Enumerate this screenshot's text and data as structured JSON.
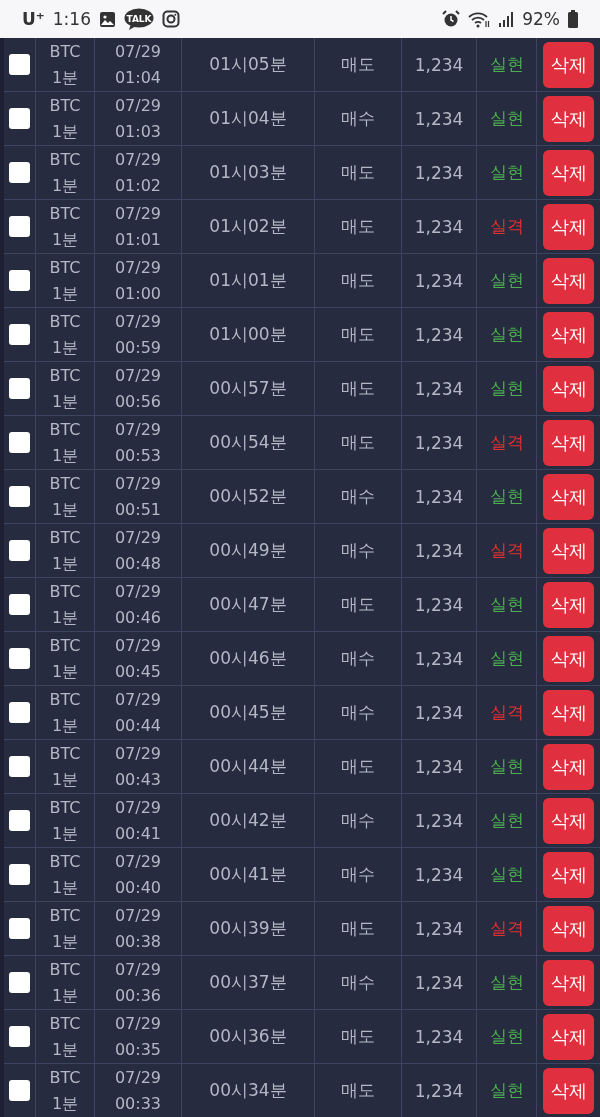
{
  "status_bar": {
    "carrier": "U⁺",
    "time": "1:16",
    "talk_badge": "TALK",
    "battery": "92%"
  },
  "rows": [
    {
      "checked": false,
      "coin": "BTC",
      "interval": "1분",
      "date": "07/29",
      "time": "01:04",
      "slot": "01시05분",
      "side": "매도",
      "amount": "1,234",
      "result": "실현",
      "kind": "win",
      "action": "삭제"
    },
    {
      "checked": false,
      "coin": "BTC",
      "interval": "1분",
      "date": "07/29",
      "time": "01:03",
      "slot": "01시04분",
      "side": "매수",
      "amount": "1,234",
      "result": "실현",
      "kind": "win",
      "action": "삭제"
    },
    {
      "checked": false,
      "coin": "BTC",
      "interval": "1분",
      "date": "07/29",
      "time": "01:02",
      "slot": "01시03분",
      "side": "매도",
      "amount": "1,234",
      "result": "실현",
      "kind": "win",
      "action": "삭제"
    },
    {
      "checked": false,
      "coin": "BTC",
      "interval": "1분",
      "date": "07/29",
      "time": "01:01",
      "slot": "01시02분",
      "side": "매도",
      "amount": "1,234",
      "result": "실격",
      "kind": "loss",
      "action": "삭제"
    },
    {
      "checked": false,
      "coin": "BTC",
      "interval": "1분",
      "date": "07/29",
      "time": "01:00",
      "slot": "01시01분",
      "side": "매도",
      "amount": "1,234",
      "result": "실현",
      "kind": "win",
      "action": "삭제"
    },
    {
      "checked": false,
      "coin": "BTC",
      "interval": "1분",
      "date": "07/29",
      "time": "00:59",
      "slot": "01시00분",
      "side": "매도",
      "amount": "1,234",
      "result": "실현",
      "kind": "win",
      "action": "삭제"
    },
    {
      "checked": false,
      "coin": "BTC",
      "interval": "1분",
      "date": "07/29",
      "time": "00:56",
      "slot": "00시57분",
      "side": "매도",
      "amount": "1,234",
      "result": "실현",
      "kind": "win",
      "action": "삭제"
    },
    {
      "checked": false,
      "coin": "BTC",
      "interval": "1분",
      "date": "07/29",
      "time": "00:53",
      "slot": "00시54분",
      "side": "매도",
      "amount": "1,234",
      "result": "실격",
      "kind": "loss",
      "action": "삭제"
    },
    {
      "checked": false,
      "coin": "BTC",
      "interval": "1분",
      "date": "07/29",
      "time": "00:51",
      "slot": "00시52분",
      "side": "매수",
      "amount": "1,234",
      "result": "실현",
      "kind": "win",
      "action": "삭제"
    },
    {
      "checked": false,
      "coin": "BTC",
      "interval": "1분",
      "date": "07/29",
      "time": "00:48",
      "slot": "00시49분",
      "side": "매수",
      "amount": "1,234",
      "result": "실격",
      "kind": "loss",
      "action": "삭제"
    },
    {
      "checked": false,
      "coin": "BTC",
      "interval": "1분",
      "date": "07/29",
      "time": "00:46",
      "slot": "00시47분",
      "side": "매도",
      "amount": "1,234",
      "result": "실현",
      "kind": "win",
      "action": "삭제"
    },
    {
      "checked": false,
      "coin": "BTC",
      "interval": "1분",
      "date": "07/29",
      "time": "00:45",
      "slot": "00시46분",
      "side": "매수",
      "amount": "1,234",
      "result": "실현",
      "kind": "win",
      "action": "삭제"
    },
    {
      "checked": false,
      "coin": "BTC",
      "interval": "1분",
      "date": "07/29",
      "time": "00:44",
      "slot": "00시45분",
      "side": "매수",
      "amount": "1,234",
      "result": "실격",
      "kind": "loss",
      "action": "삭제"
    },
    {
      "checked": false,
      "coin": "BTC",
      "interval": "1분",
      "date": "07/29",
      "time": "00:43",
      "slot": "00시44분",
      "side": "매도",
      "amount": "1,234",
      "result": "실현",
      "kind": "win",
      "action": "삭제"
    },
    {
      "checked": false,
      "coin": "BTC",
      "interval": "1분",
      "date": "07/29",
      "time": "00:41",
      "slot": "00시42분",
      "side": "매수",
      "amount": "1,234",
      "result": "실현",
      "kind": "win",
      "action": "삭제"
    },
    {
      "checked": false,
      "coin": "BTC",
      "interval": "1분",
      "date": "07/29",
      "time": "00:40",
      "slot": "00시41분",
      "side": "매수",
      "amount": "1,234",
      "result": "실현",
      "kind": "win",
      "action": "삭제"
    },
    {
      "checked": false,
      "coin": "BTC",
      "interval": "1분",
      "date": "07/29",
      "time": "00:38",
      "slot": "00시39분",
      "side": "매도",
      "amount": "1,234",
      "result": "실격",
      "kind": "loss",
      "action": "삭제"
    },
    {
      "checked": false,
      "coin": "BTC",
      "interval": "1분",
      "date": "07/29",
      "time": "00:36",
      "slot": "00시37분",
      "side": "매수",
      "amount": "1,234",
      "result": "실현",
      "kind": "win",
      "action": "삭제"
    },
    {
      "checked": false,
      "coin": "BTC",
      "interval": "1분",
      "date": "07/29",
      "time": "00:35",
      "slot": "00시36분",
      "side": "매도",
      "amount": "1,234",
      "result": "실현",
      "kind": "win",
      "action": "삭제"
    },
    {
      "checked": false,
      "coin": "BTC",
      "interval": "1분",
      "date": "07/29",
      "time": "00:33",
      "slot": "00시34분",
      "side": "매도",
      "amount": "1,234",
      "result": "실현",
      "kind": "win",
      "action": "삭제"
    }
  ]
}
